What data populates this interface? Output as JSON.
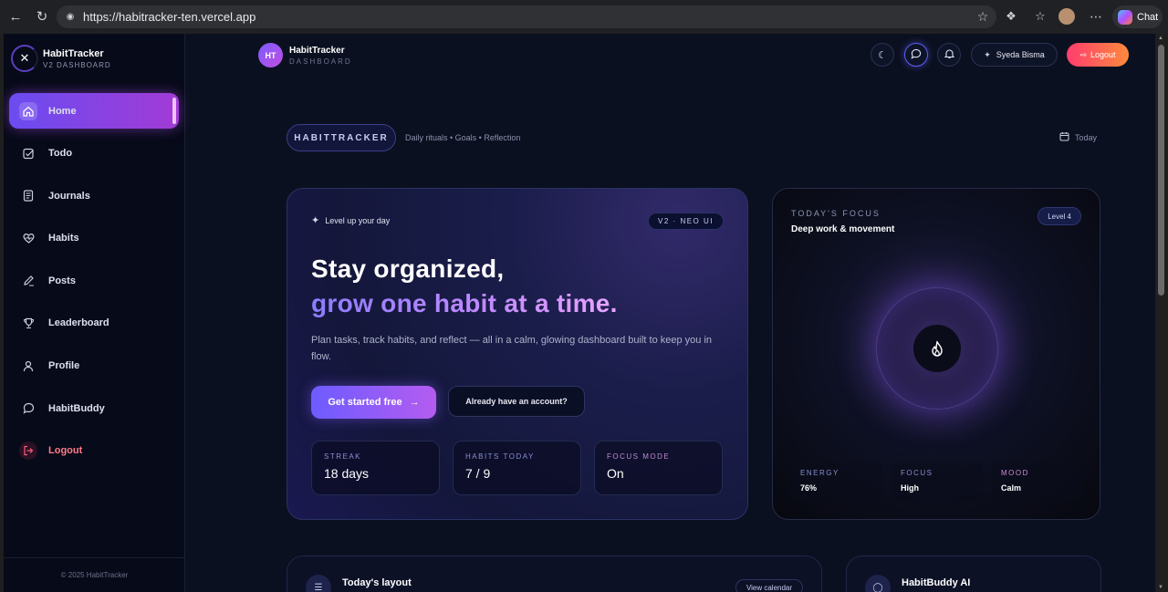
{
  "browser": {
    "url": "https://habitracker-ten.vercel.app",
    "chat_label": "Chat"
  },
  "sidebar": {
    "title": "HabitTracker",
    "subtitle": "V2 DASHBOARD",
    "items": [
      {
        "label": "Home",
        "icon": "home-icon"
      },
      {
        "label": "Todo",
        "icon": "checkbox-icon"
      },
      {
        "label": "Journals",
        "icon": "journal-icon"
      },
      {
        "label": "Habits",
        "icon": "heart-pulse-icon"
      },
      {
        "label": "Posts",
        "icon": "pen-icon"
      },
      {
        "label": "Leaderboard",
        "icon": "trophy-icon"
      },
      {
        "label": "Profile",
        "icon": "user-icon"
      },
      {
        "label": "HabitBuddy",
        "icon": "chat-bubble-icon"
      },
      {
        "label": "Logout",
        "icon": "logout-icon"
      }
    ],
    "footer": "© 2025 HabitTracker"
  },
  "topbar": {
    "avatar_initials": "HT",
    "brand_title": "HabitTracker",
    "brand_subtitle": "DASHBOARD",
    "user_name": "Syeda Bisma",
    "logout_label": "Logout"
  },
  "header": {
    "pill": "HABITTRACKER",
    "tagline": "Daily rituals • Goals • Reflection",
    "date_label": "Today"
  },
  "hero": {
    "eyebrow": "Level up your day",
    "version": "V2 · NEO UI",
    "headline_1": "Stay organized,",
    "headline_2": "grow one habit at a time.",
    "description": "Plan tasks, track habits, and reflect — all in a calm, glowing dashboard built to keep you in flow.",
    "cta_primary": "Get started free",
    "cta_secondary": "Already have an account?",
    "stats": [
      {
        "label": "STREAK",
        "value": "18 days"
      },
      {
        "label": "HABITS TODAY",
        "value": "7 / 9"
      },
      {
        "label": "FOCUS MODE",
        "value": "On"
      }
    ]
  },
  "focus": {
    "label": "TODAY'S FOCUS",
    "title": "Deep work & movement",
    "level": "Level 4",
    "stats": [
      {
        "label": "ENERGY",
        "value": "76%"
      },
      {
        "label": "FOCUS",
        "value": "High"
      },
      {
        "label": "MOOD",
        "value": "Calm"
      }
    ]
  },
  "bottom": {
    "layout_title": "Today's layout",
    "layout_button": "View calendar",
    "ai_title": "HabitBuddy AI"
  },
  "colors": {
    "accent": "#7b5cff",
    "accent_2": "#b45cf0",
    "logout_gradient_start": "#ff3d6e",
    "logout_gradient_end": "#ff8a3c",
    "background": "#0b1020"
  }
}
